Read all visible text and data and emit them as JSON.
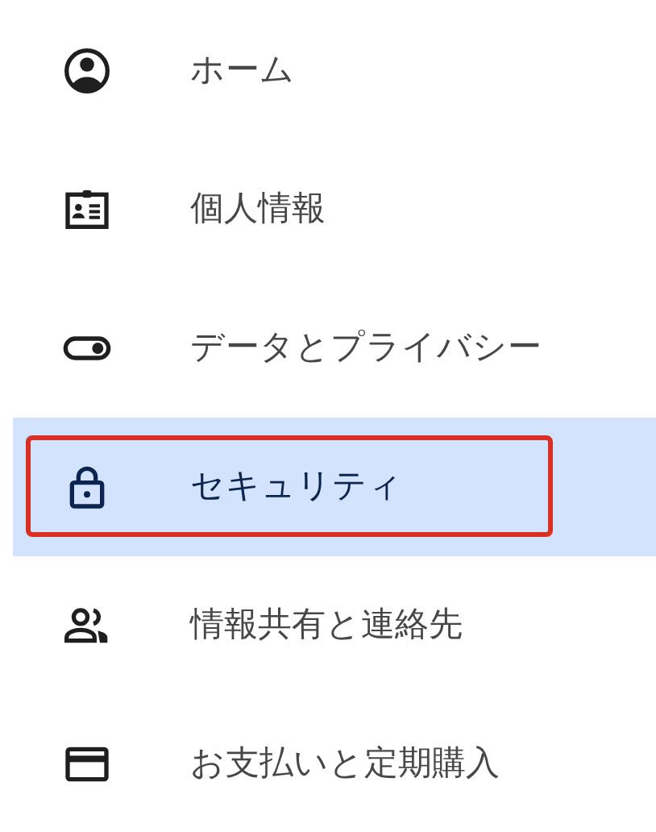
{
  "sidebar": {
    "items": [
      {
        "label": "ホーム",
        "selected": false,
        "outlined": false
      },
      {
        "label": "個人情報",
        "selected": false,
        "outlined": false
      },
      {
        "label": "データとプライバシー",
        "selected": false,
        "outlined": false
      },
      {
        "label": "セキュリティ",
        "selected": true,
        "outlined": true
      },
      {
        "label": "情報共有と連絡先",
        "selected": false,
        "outlined": false
      },
      {
        "label": "お支払いと定期購入",
        "selected": false,
        "outlined": false
      }
    ]
  }
}
